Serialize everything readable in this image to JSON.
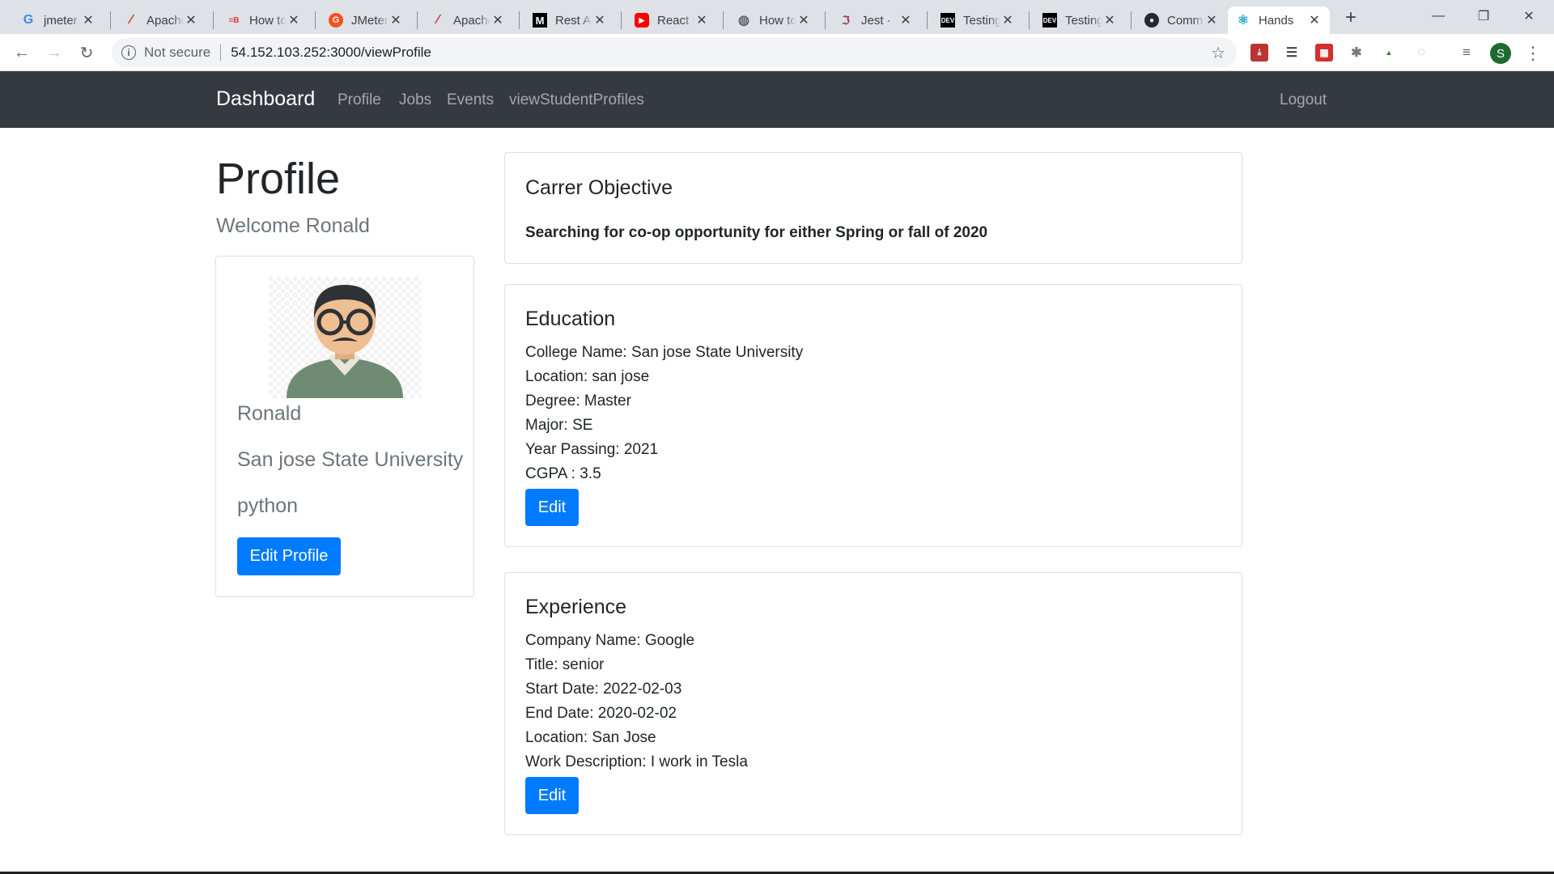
{
  "browser": {
    "tabs": [
      {
        "title": "jmeter",
        "icon": "google-icon"
      },
      {
        "title": "Apache",
        "icon": "apache-feather-icon"
      },
      {
        "title": "How to",
        "icon": "blazemeter-icon"
      },
      {
        "title": "JMeter",
        "icon": "jmeter-g-icon"
      },
      {
        "title": "Apache",
        "icon": "apache-feather-icon"
      },
      {
        "title": "Rest API",
        "icon": "medium-icon"
      },
      {
        "title": "React F",
        "icon": "youtube-icon"
      },
      {
        "title": "How to",
        "icon": "globe-icon"
      },
      {
        "title": "Jest ·",
        "icon": "jest-icon"
      },
      {
        "title": "Testing",
        "icon": "dev-icon"
      },
      {
        "title": "Testing",
        "icon": "dev-icon"
      },
      {
        "title": "Comm",
        "icon": "github-icon"
      },
      {
        "title": "Hands",
        "icon": "react-icon"
      }
    ],
    "new_tab_glyph": "+",
    "security_label": "Not secure",
    "url": "54.152.103.252:3000/viewProfile",
    "profile_initial": "S"
  },
  "navbar": {
    "brand": "Dashboard",
    "links": [
      "Profile",
      "Jobs",
      "Events",
      "viewStudentProfiles"
    ],
    "logout": "Logout"
  },
  "profile": {
    "title": "Profile",
    "welcome": "Welcome Ronald",
    "name": "Ronald",
    "college": "San jose State University",
    "skill": "python",
    "edit_button": "Edit Profile"
  },
  "objective": {
    "title": "Carrer Objective",
    "text": "Searching for co-op opportunity for either Spring or fall of 2020"
  },
  "education": {
    "title": "Education",
    "lines": [
      "College Name: San jose State University",
      "Location: san jose",
      "Degree: Master",
      "Major: SE",
      "Year Passing: 2021",
      "CGPA : 3.5"
    ],
    "edit_button": "Edit"
  },
  "experience": {
    "title": "Experience",
    "lines": [
      "Company Name: Google",
      "Title: senior",
      "Start Date: 2022-02-03",
      "End Date: 2020-02-02",
      "Location: San Jose",
      "Work Description: I work in Tesla"
    ],
    "edit_button": "Edit"
  },
  "colors": {
    "navbar_bg": "#343a40",
    "primary": "#007bff",
    "muted": "#6c757d"
  }
}
